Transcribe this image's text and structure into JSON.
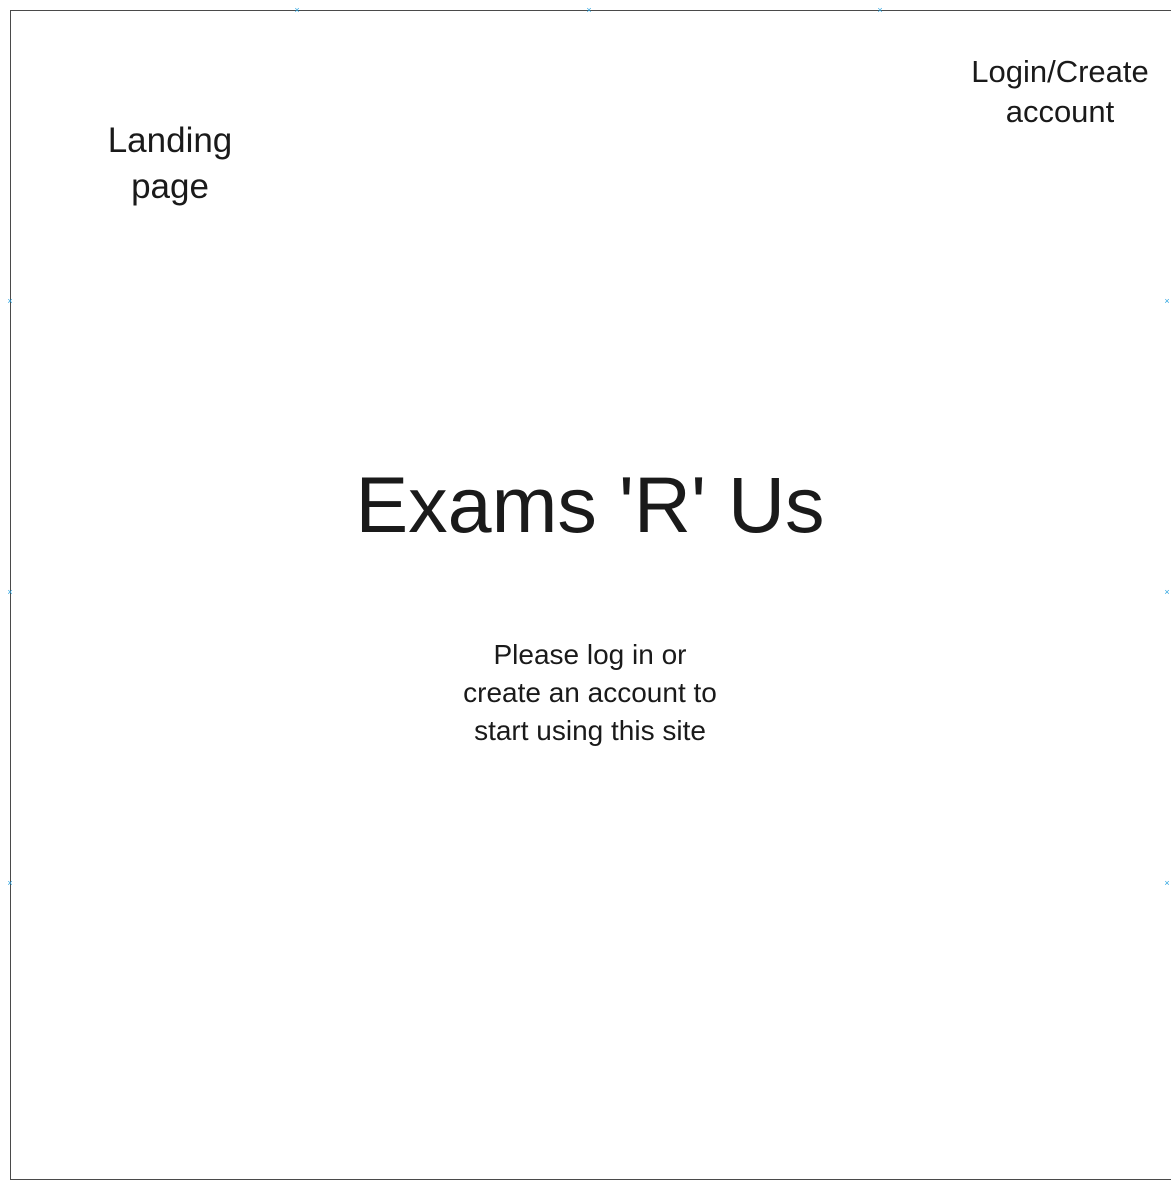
{
  "page": {
    "label_lines": [
      "Landing",
      "page"
    ]
  },
  "header": {
    "login_lines": [
      "Login/Create",
      "account"
    ]
  },
  "main": {
    "title": "Exams 'R' Us",
    "message_lines": [
      "Please log in or",
      "create an account to",
      "start using this site"
    ]
  },
  "colors": {
    "frame_border": "#4a4a4a",
    "selection_handle": "#29a3e0",
    "text": "#1a1a1a",
    "background": "#ffffff"
  }
}
